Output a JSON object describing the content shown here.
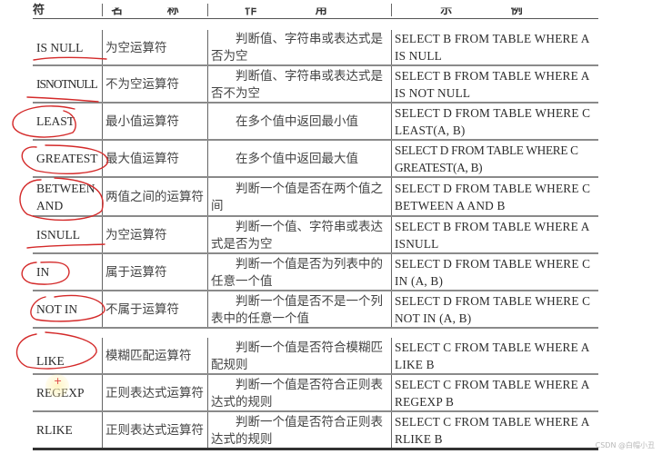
{
  "table": {
    "headers": [
      "运 算 符",
      "名 称",
      "作 用",
      "示 例"
    ],
    "rows": [
      {
        "operator": "IS NULL",
        "name": "为空运算符",
        "function": "判断值、字符串或表达式是否为空",
        "example": "SELECT B FROM TABLE WHERE A IS NULL",
        "annotation": "underline"
      },
      {
        "operator": "ISNOTNULL",
        "name": "不为空运算符",
        "function": "判断值、字符串或表达式是否不为空",
        "example": "SELECT B FROM TABLE WHERE A IS NOT NULL",
        "annotation": "underline"
      },
      {
        "operator": "LEAST",
        "name": "最小值运算符",
        "function": "在多个值中返回最小值",
        "example": "SELECT D FROM TABLE WHERE C LEAST(A, B)",
        "annotation": "circle"
      },
      {
        "operator": "GREATEST",
        "name": "最大值运算符",
        "function": "在多个值中返回最大值",
        "example": "SELECT D FROM TABLE WHERE C GREATEST(A, B)",
        "annotation": "circle"
      },
      {
        "operator": "BETWEEN AND",
        "name": "两值之间的运算符",
        "function": "判断一个值是否在两个值之间",
        "example": "SELECT D FROM TABLE WHERE C BETWEEN A AND B",
        "annotation": "circle"
      },
      {
        "operator": "ISNULL",
        "name": "为空运算符",
        "function": "判断一个值、字符串或表达式是否为空",
        "example": "SELECT B FROM TABLE WHERE A ISNULL",
        "annotation": "underline"
      },
      {
        "operator": "IN",
        "name": "属于运算符",
        "function": "判断一个值是否为列表中的任意一个值",
        "example": "SELECT D FROM TABLE WHERE C IN (A, B)",
        "annotation": "circle"
      },
      {
        "operator": "NOT IN",
        "name": "不属于运算符",
        "function": "判断一个值是否不是一个列表中的任意一个值",
        "example": "SELECT D FROM TABLE WHERE C NOT IN (A, B)",
        "annotation": "circle"
      },
      {
        "operator": "LIKE",
        "name": "模糊匹配运算符",
        "function": "判断一个值是否符合模糊匹配规则",
        "example": "SELECT C FROM TABLE WHERE A LIKE B",
        "annotation": "circle"
      },
      {
        "operator": "REGEXP",
        "name": "正则表达式运算符",
        "function": "判断一个值是否符合正则表达式的规则",
        "example": "SELECT C FROM TABLE WHERE A REGEXP B",
        "annotation": "none"
      },
      {
        "operator": "RLIKE",
        "name": "正则表达式运算符",
        "function": "判断一个值是否符合正则表达式的规则",
        "example": "SELECT C FROM TABLE WHERE A RLIKE B",
        "annotation": "none"
      }
    ]
  },
  "cursor_marker": "+",
  "annotation_color": "#d42a2a",
  "watermark": "CSDN @白帽小丑"
}
